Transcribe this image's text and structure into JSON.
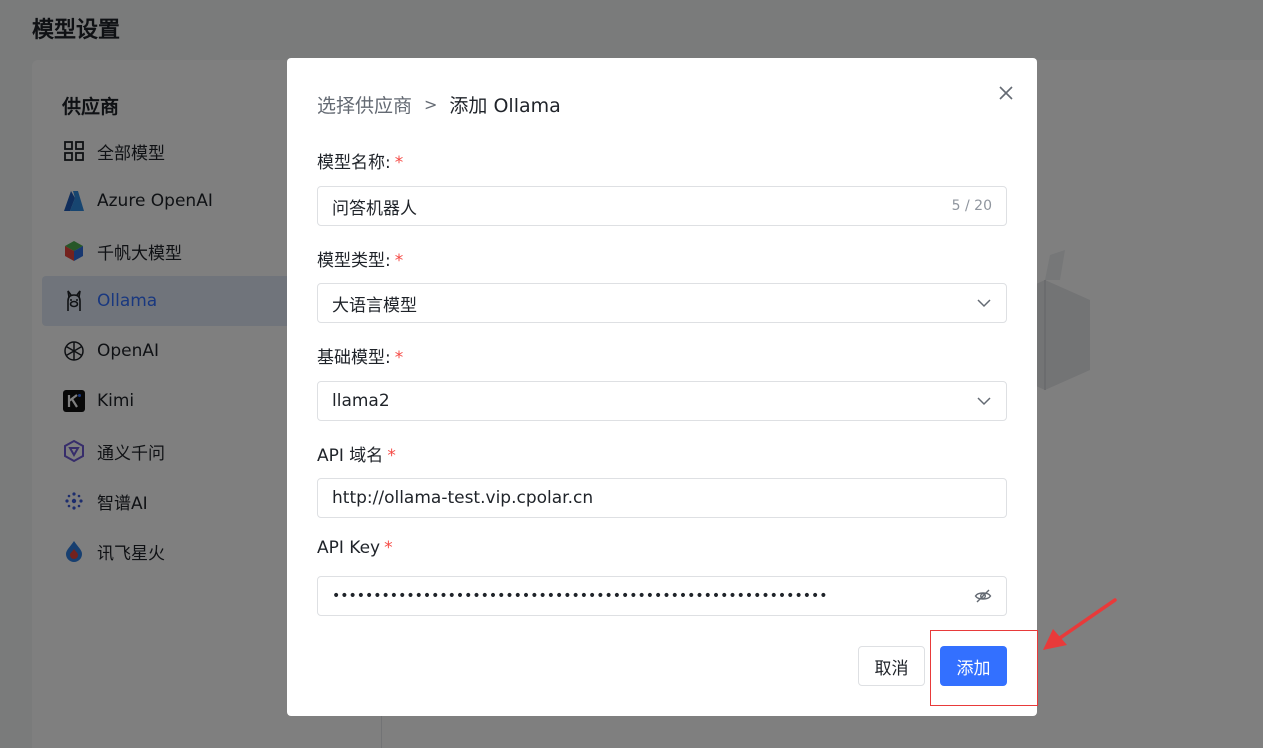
{
  "page": {
    "title": "模型设置"
  },
  "sidebar": {
    "title": "供应商",
    "items": [
      {
        "label": "全部模型",
        "icon": "grid-icon"
      },
      {
        "label": "Azure OpenAI",
        "icon": "azure-icon"
      },
      {
        "label": "千帆大模型",
        "icon": "qianfan-icon"
      },
      {
        "label": "Ollama",
        "icon": "ollama-icon",
        "active": true
      },
      {
        "label": "OpenAI",
        "icon": "openai-icon"
      },
      {
        "label": "Kimi",
        "icon": "kimi-icon"
      },
      {
        "label": "通义千问",
        "icon": "tongyi-icon"
      },
      {
        "label": "智谱AI",
        "icon": "zhipu-icon"
      },
      {
        "label": "讯飞星火",
        "icon": "xunfei-icon"
      }
    ]
  },
  "dialog": {
    "breadcrumb_prev": "选择供应商",
    "breadcrumb_sep": ">",
    "breadcrumb_current": "添加 Ollama",
    "name_label": "模型名称:",
    "name_value": "问答机器人",
    "name_counter": "5 / 20",
    "type_label": "模型类型:",
    "type_value": "大语言模型",
    "base_label": "基础模型:",
    "base_value": "llama2",
    "domain_label": "API 域名",
    "domain_value": "http://ollama-test.vip.cpolar.cn",
    "key_label": "API Key",
    "key_value": "••••••••••••••••••••••••••••••••••••••••••••••••••••••••••••",
    "required_mark": "*",
    "cancel_label": "取消",
    "add_label": "添加"
  },
  "colors": {
    "accent": "#3370ff",
    "required": "#f54a45",
    "annotation": "#e83a3a"
  }
}
